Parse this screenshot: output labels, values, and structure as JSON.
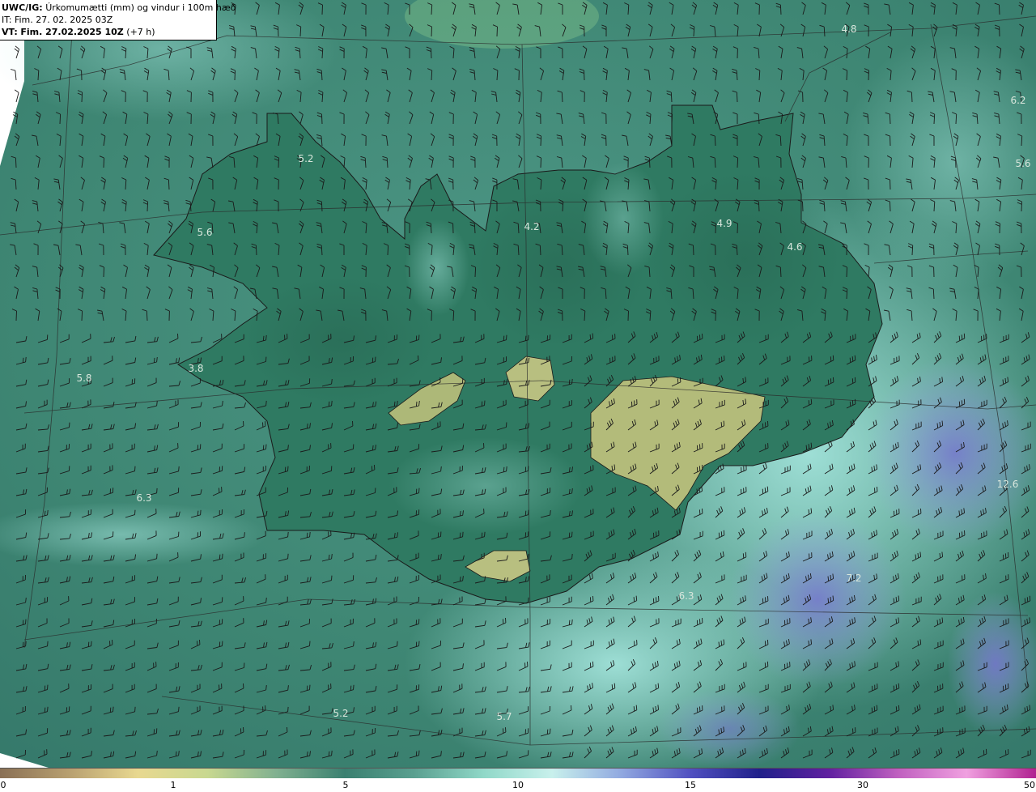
{
  "header": {
    "product": "UWC/IG:",
    "title": "Úrkomumætti (mm) og vindur i 100m hæð",
    "init_prefix": "IT:",
    "init_time": "Fim. 27. 02. 2025 03Z",
    "valid_prefix": "VT:",
    "valid_time": "Fim. 27.02.2025 10Z",
    "lead": "(+7 h)"
  },
  "map_values": [
    "4.8",
    "6.2",
    "5.6",
    "5.2",
    "4.2",
    "4.9",
    "4.6",
    "5.6",
    "3.8",
    "5.8",
    "6.3",
    "6.3",
    "5.2",
    "5.7",
    "12.6",
    "7.2"
  ],
  "colorbar": {
    "ticks": [
      "0",
      "1",
      "5",
      "10",
      "15",
      "30",
      "50"
    ],
    "colors": [
      "#8a7055",
      "#b8a070",
      "#e8d890",
      "#c8d890",
      "#80b090",
      "#3a8070",
      "#5aa090",
      "#90d8c8",
      "#c8f0ec",
      "#90a8e0",
      "#5050c0",
      "#20208a",
      "#6020a0",
      "#c060c0",
      "#f0a0e0",
      "#b02090"
    ]
  }
}
